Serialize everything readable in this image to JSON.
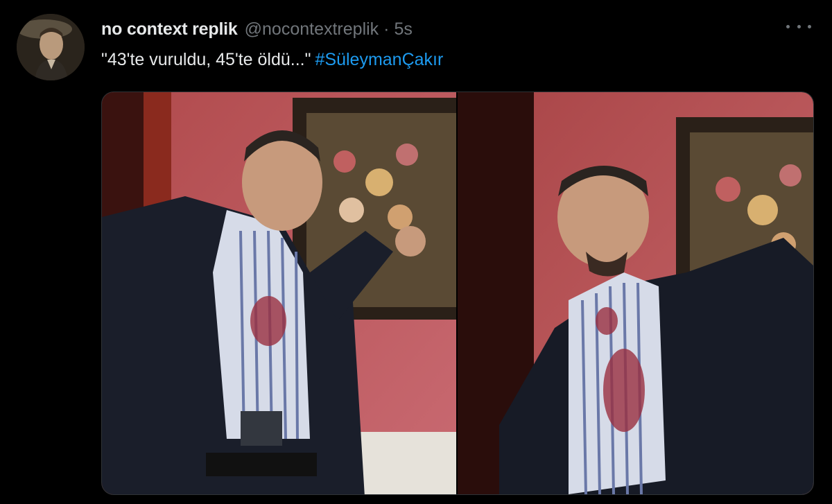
{
  "tweet": {
    "author": {
      "display_name": "no context replik",
      "handle": "@nocontextreplik"
    },
    "separator": "·",
    "timestamp": "5s",
    "text": "\"43'te vuruldu, 45'te öldü...\"",
    "hashtag": "#SüleymanÇakır",
    "icons": {
      "more": "more-options-icon"
    },
    "colors": {
      "link": "#1d9bf0",
      "secondary": "#71767b",
      "background": "#000000"
    }
  }
}
